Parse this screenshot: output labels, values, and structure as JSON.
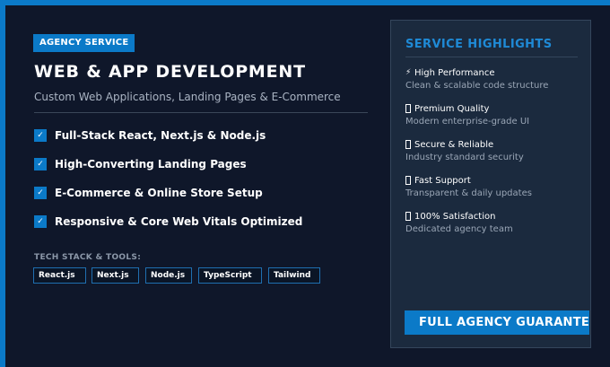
{
  "badge": "AGENCY SERVICE",
  "title": "WEB & APP DEVELOPMENT",
  "subtitle": "Custom Web Applications, Landing Pages & E-Commerce",
  "features": [
    {
      "label": "Full-Stack React, Next.js & Node.js"
    },
    {
      "label": "High-Converting Landing Pages"
    },
    {
      "label": "E-Commerce & Online Store Setup"
    },
    {
      "label": "Responsive & Core Web Vitals Optimized"
    }
  ],
  "check_glyph": "✓",
  "tech_stack": {
    "title": "TECH STACK & TOOLS:",
    "items": [
      "React.js",
      "Next.js",
      "Node.js",
      "TypeScript",
      "Tailwind"
    ]
  },
  "highlights": {
    "title": "SERVICE HIGHLIGHTS",
    "items": [
      {
        "icon": "lightning-icon",
        "glyph": "⚡",
        "title": "High Performance",
        "desc": "Clean & scalable code structure"
      },
      {
        "icon": "missing-glyph-icon",
        "title": "Premium Quality",
        "desc": "Modern enterprise-grade UI"
      },
      {
        "icon": "missing-glyph-icon",
        "title": "Secure & Reliable",
        "desc": "Industry standard security"
      },
      {
        "icon": "missing-glyph-icon",
        "title": "Fast Support",
        "desc": "Transparent & daily updates"
      },
      {
        "icon": "missing-glyph-icon",
        "title": "100% Satisfaction",
        "desc": "Dedicated agency team"
      }
    ]
  },
  "cta": "FULL AGENCY GUARANTEE",
  "colors": {
    "background": "#0f172a",
    "accent": "#0b7ac8",
    "card": "#1b2a3e",
    "card_title": "#1f8ad6"
  }
}
